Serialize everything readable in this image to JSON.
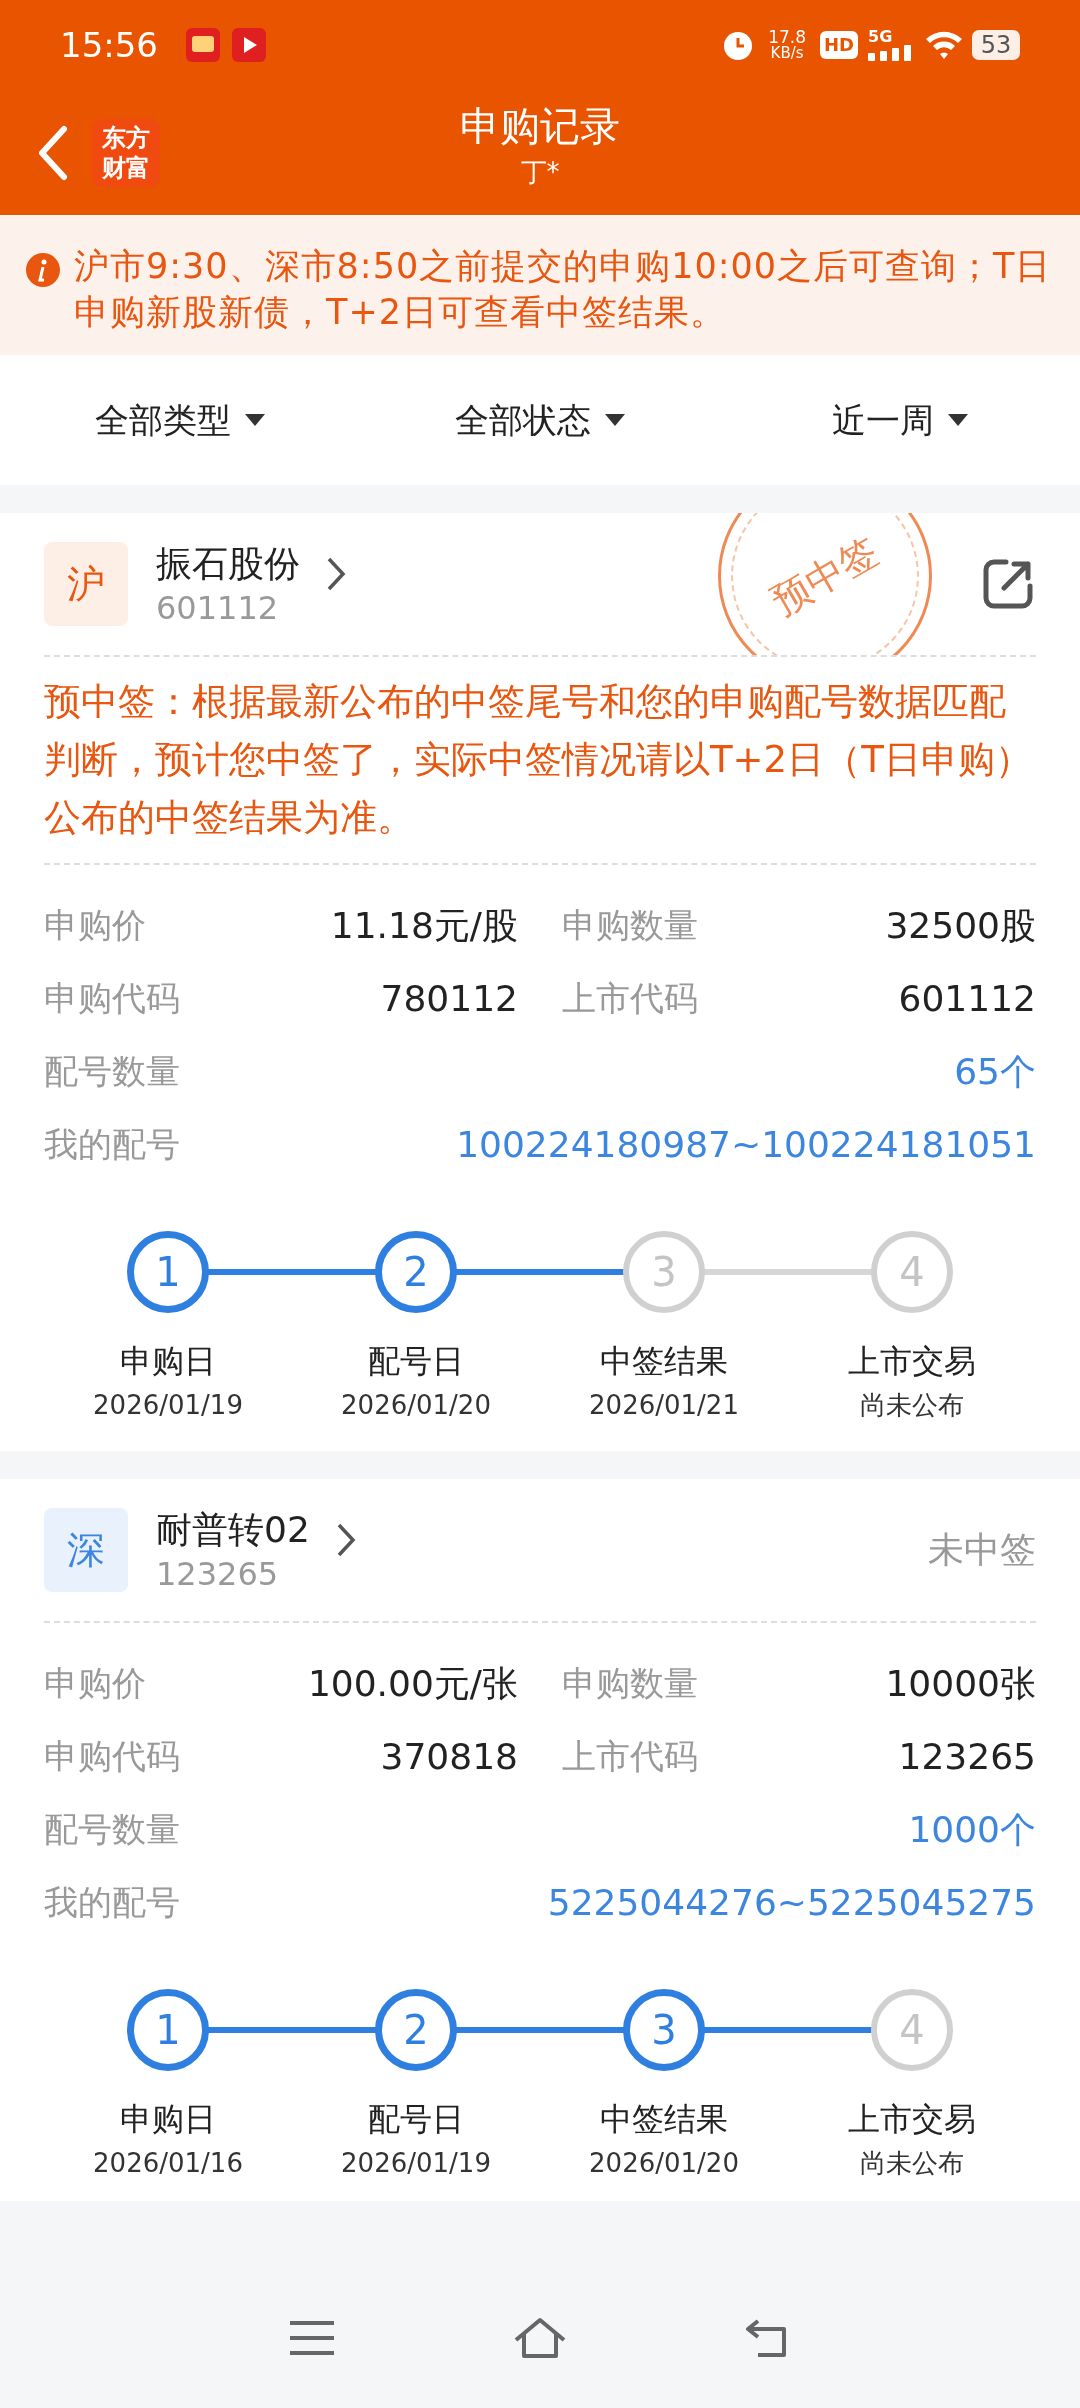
{
  "status_bar": {
    "time": "15:56",
    "speed_value": "17.8",
    "speed_unit": "KB/s",
    "hd": "HD",
    "network": "5G",
    "battery": "53"
  },
  "header": {
    "logo_line_1": "东方",
    "logo_line_2": "财富",
    "title": "申购记录",
    "subtitle": "丁*"
  },
  "notice": {
    "text": "沪市9:30、深市8:50之前提交的申购10:00之后可查询；T日申购新股新债，T+2日可查看中签结果。"
  },
  "filters": [
    {
      "label": "全部类型"
    },
    {
      "label": "全部状态"
    },
    {
      "label": "近一周"
    }
  ],
  "records": [
    {
      "market": {
        "label": "沪",
        "kind": "sh"
      },
      "name": "振石股份",
      "code": "601112",
      "status": {
        "text": "预中签",
        "kind": "stamp"
      },
      "share": true,
      "description": "预中签：根据最新公布的中签尾号和您的申购配号数据匹配判断，预计您中签了，实际中签情况请以T+2日（T日申购）公布的中签结果为准。",
      "rows": [
        [
          {
            "label": "申购价",
            "value": "11.18元/股",
            "kind": "plain"
          },
          {
            "label": "申购数量",
            "value": "32500股",
            "kind": "plain"
          }
        ],
        [
          {
            "label": "申购代码",
            "value": "780112",
            "kind": "plain"
          },
          {
            "label": "上市代码",
            "value": "601112",
            "kind": "plain"
          }
        ],
        [
          {
            "label": "配号数量",
            "value": "65个",
            "kind": "link"
          }
        ],
        [
          {
            "label": "我的配号",
            "value": "100224180987~100224181051",
            "kind": "link"
          }
        ]
      ],
      "steps": [
        {
          "number": "1",
          "label": "申购日",
          "date": "2026/01/19",
          "done": true
        },
        {
          "number": "2",
          "label": "配号日",
          "date": "2026/01/20",
          "done": true
        },
        {
          "number": "3",
          "label": "中签结果",
          "date": "2026/01/21",
          "done": false
        },
        {
          "number": "4",
          "label": "上市交易",
          "date": "尚未公布",
          "done": false
        }
      ]
    },
    {
      "market": {
        "label": "深",
        "kind": "sz"
      },
      "name": "耐普转02",
      "code": "123265",
      "status": {
        "text": "未中签",
        "kind": "text"
      },
      "share": false,
      "rows": [
        [
          {
            "label": "申购价",
            "value": "100.00元/张",
            "kind": "plain"
          },
          {
            "label": "申购数量",
            "value": "10000张",
            "kind": "plain"
          }
        ],
        [
          {
            "label": "申购代码",
            "value": "370818",
            "kind": "plain"
          },
          {
            "label": "上市代码",
            "value": "123265",
            "kind": "plain"
          }
        ],
        [
          {
            "label": "配号数量",
            "value": "1000个",
            "kind": "link"
          }
        ],
        [
          {
            "label": "我的配号",
            "value": "5225044276~5225045275",
            "kind": "link"
          }
        ]
      ],
      "steps": [
        {
          "number": "1",
          "label": "申购日",
          "date": "2026/01/16",
          "done": true
        },
        {
          "number": "2",
          "label": "配号日",
          "date": "2026/01/19",
          "done": true
        },
        {
          "number": "3",
          "label": "中签结果",
          "date": "2026/01/20",
          "done": true
        },
        {
          "number": "4",
          "label": "上市交易",
          "date": "尚未公布",
          "done": false
        }
      ]
    }
  ]
}
